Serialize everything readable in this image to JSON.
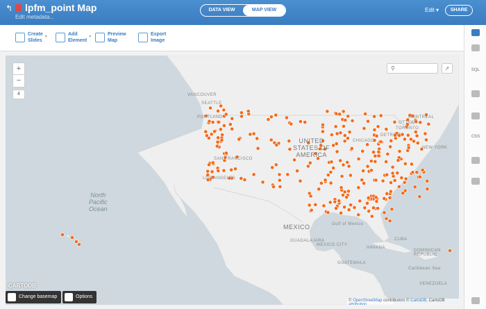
{
  "header": {
    "title": "lpfm_point Map",
    "subtitle": "Edit metadata...",
    "view_data": "DATA VIEW",
    "view_map": "MAP VIEW",
    "edit": "Edit",
    "share": "SHARE",
    "accent": "#3a7cc0"
  },
  "toolbar": {
    "create_slides": [
      "Create",
      "Slides"
    ],
    "add_element": [
      "Add",
      "Element"
    ],
    "preview_map": [
      "Preview",
      "Map"
    ],
    "export_image": [
      "Export",
      "Image"
    ]
  },
  "map": {
    "zoom_in": "+",
    "zoom_out": "−",
    "zoom_level": "4",
    "search_placeholder": "",
    "point_color": "#f26a1b",
    "labels": {
      "vancouver": "VANCOUVER",
      "seattle": "SEATTLE",
      "portland": "PORTLAND",
      "san_francisco": "SAN FRANCISCO",
      "los_angeles": "LOS ANGELES",
      "montreal": "MONTRÉAL",
      "ottawa": "OTTAWA",
      "toronto": "TORONTO",
      "detroit": "DETROIT",
      "chicago": "CHICAGO",
      "new_york": "NEW YORK",
      "gulf": "Gulf of Mexico",
      "guadalajara": "GUADALAJARA",
      "mexico_city": "MEXICO CITY",
      "guatemala": "GUATEMALA",
      "cuba": "CUBA",
      "dominican": "DOMINICAN REPUBLIC",
      "caribbean": "Caribbean Sea",
      "venezuela": "VENEZUELA",
      "havana": "HAVANA"
    },
    "ocean": [
      "North",
      "Pacific",
      "Ocean"
    ],
    "countries": {
      "usa": [
        "UNITED",
        "STATES OF",
        "AMERICA"
      ],
      "mexico": "MEXICO"
    },
    "brand": "CARTODB",
    "change_basemap": "Change basemap",
    "options": "Options",
    "attribution_prefix": "© ",
    "attribution_osm": "OpenStreetMap",
    "attribution_mid": " contributors © ",
    "attribution_cartodb": "CartoDB",
    "attribution_tail": ", CartoDB ",
    "attribution_link": "attribution"
  },
  "sidebar": {
    "sql": "SQL",
    "css": "CSS"
  }
}
